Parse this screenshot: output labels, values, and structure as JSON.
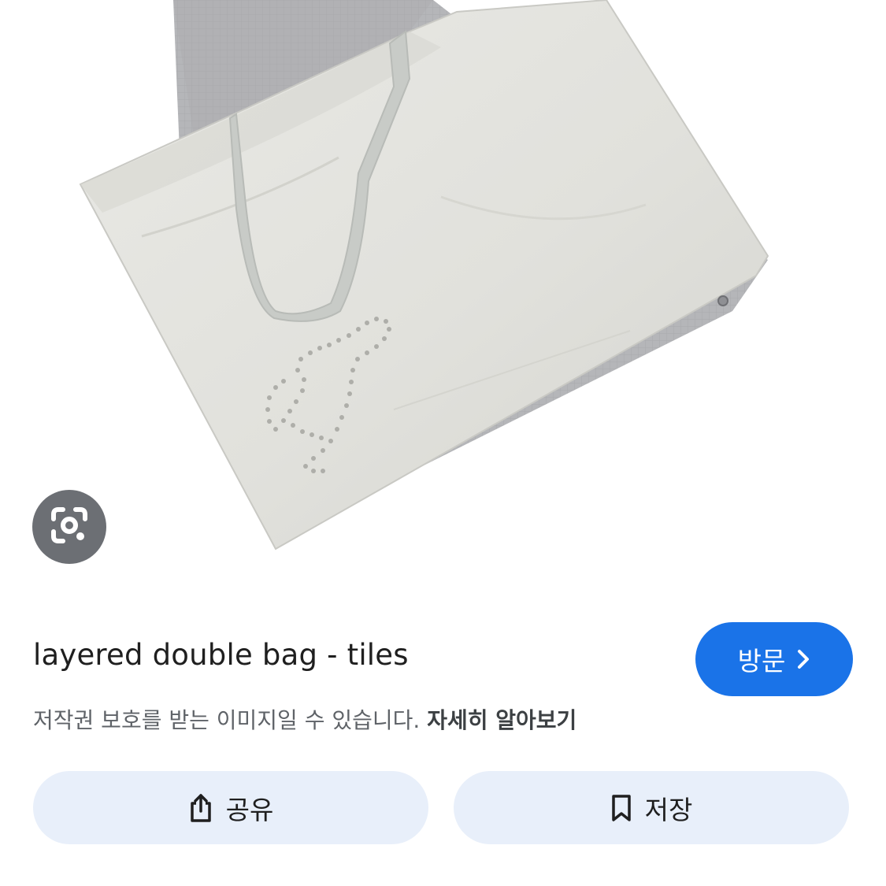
{
  "result": {
    "title": "layered double bag - tiles",
    "visit_label": "방문",
    "notice_text": "저작권 보호를 받는 이미지일 수 있습니다.",
    "notice_link": "자세히 알아보기"
  },
  "actions": {
    "share_label": "공유",
    "save_label": "저장"
  },
  "icons": {
    "lens": "google-lens-icon",
    "visit_chevron": "chevron-right-icon",
    "share": "share-icon",
    "save": "bookmark-icon"
  },
  "colors": {
    "accent": "#1a73e8",
    "action_bg": "#e8effa",
    "lens_bg": "#5f6368"
  }
}
